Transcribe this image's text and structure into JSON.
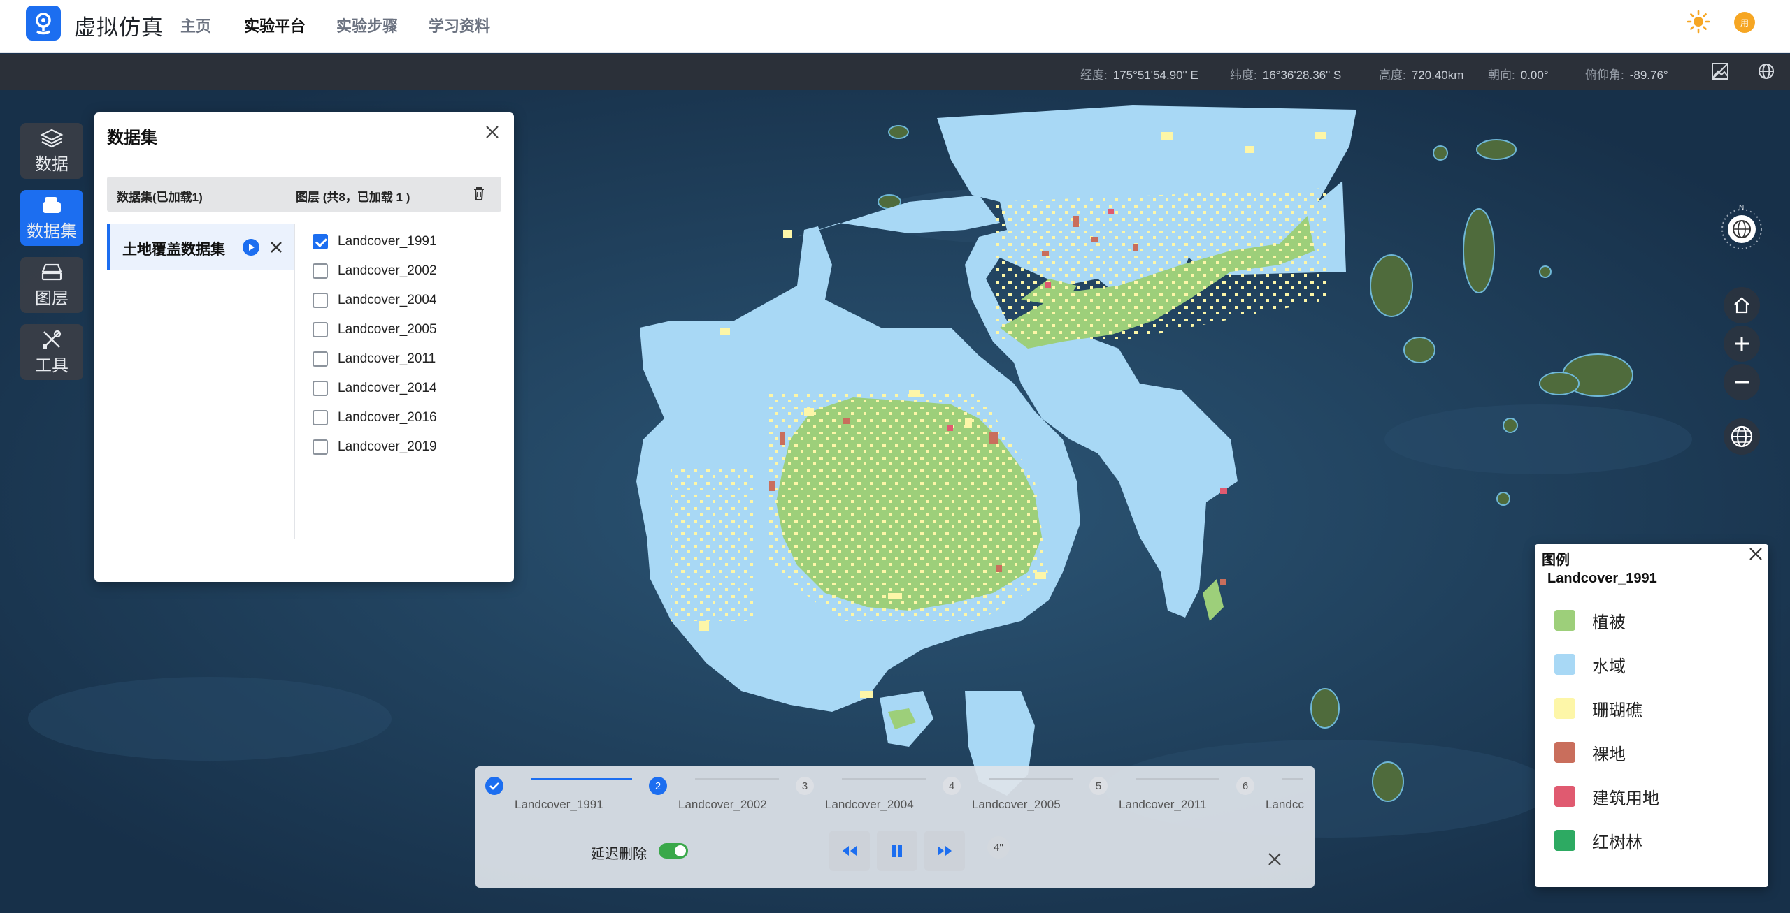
{
  "app": {
    "title": "虚拟仿真",
    "nav": [
      "主页",
      "实验平台",
      "实验步骤",
      "学习资料"
    ],
    "active_nav": "实验平台",
    "avatar_text": "用"
  },
  "status": {
    "lon_label": "经度:",
    "lon": "175°51'54.90\" E",
    "lat_label": "纬度:",
    "lat": "16°36'28.36\" S",
    "alt_label": "高度:",
    "alt": "720.40km",
    "heading_label": "朝向:",
    "heading": "0.00°",
    "pitch_label": "俯仰角:",
    "pitch": "-89.76°"
  },
  "toolbar": [
    {
      "label": "数据",
      "icon": "layers-icon"
    },
    {
      "label": "数据集",
      "icon": "dataset-icon"
    },
    {
      "label": "图层",
      "icon": "layer-stack-icon"
    },
    {
      "label": "工具",
      "icon": "tools-icon"
    }
  ],
  "dataset_panel": {
    "title": "数据集",
    "col_datasets": "数据集(已加载1)",
    "col_layers": "图层 (共8，已加载 1 )",
    "dataset_name": "土地覆盖数据集",
    "layers": [
      {
        "name": "Landcover_1991",
        "checked": true
      },
      {
        "name": "Landcover_2002",
        "checked": false
      },
      {
        "name": "Landcover_2004",
        "checked": false
      },
      {
        "name": "Landcover_2005",
        "checked": false
      },
      {
        "name": "Landcover_2011",
        "checked": false
      },
      {
        "name": "Landcover_2014",
        "checked": false
      },
      {
        "name": "Landcover_2016",
        "checked": false
      },
      {
        "name": "Landcover_2019",
        "checked": false
      }
    ]
  },
  "compass": {
    "north": "N"
  },
  "legend": {
    "title": "图例",
    "layer": "Landcover_1991",
    "items": [
      {
        "label": "植被",
        "color": "#9dcf7a"
      },
      {
        "label": "水域",
        "color": "#a8d8f5"
      },
      {
        "label": "珊瑚礁",
        "color": "#fdf6a8"
      },
      {
        "label": "裸地",
        "color": "#c96e5c"
      },
      {
        "label": "建筑用地",
        "color": "#e05a70"
      },
      {
        "label": "红树林",
        "color": "#2daa62"
      }
    ]
  },
  "timeline": {
    "steps": [
      {
        "num": "",
        "label": "Landcover_1991"
      },
      {
        "num": "2",
        "label": "Landcover_2002"
      },
      {
        "num": "3",
        "label": "Landcover_2004"
      },
      {
        "num": "4",
        "label": "Landcover_2005"
      },
      {
        "num": "5",
        "label": "Landcover_2011"
      },
      {
        "num": "6",
        "label": "Landcc"
      }
    ],
    "delay_label": "延迟删除",
    "delay_on": true,
    "speed": "4''"
  },
  "colors": {
    "accent": "#1c6ef0",
    "vegetation": "#9dcf7a",
    "water": "#a8d8f5"
  }
}
